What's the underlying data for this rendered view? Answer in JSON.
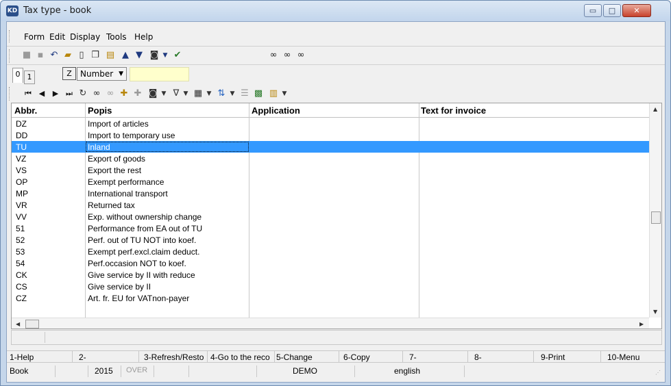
{
  "window": {
    "title": "Tax type -  book",
    "app_icon": "KD",
    "minimize_symbol": "▭",
    "maximize_symbol": "□",
    "close_symbol": "✕"
  },
  "menu": [
    "Form",
    "Edit",
    "Display",
    "Tools",
    "Help"
  ],
  "toolbar1_icons": [
    "save-icon",
    "save-as-icon",
    "undo-icon",
    "open-folder-icon",
    "new-document-icon",
    "copy-icon",
    "book-icon",
    "move-up-icon",
    "move-down-icon",
    "camera-icon",
    "dropdown-icon",
    "check-icon",
    "find-icon",
    "find-next-icon",
    "find-replace-icon"
  ],
  "tabs": [
    "0",
    "1"
  ],
  "z_button": "Z",
  "sort_select": "Number",
  "toolbar2_icons": [
    "first-record-icon",
    "previous-record-icon",
    "next-record-icon",
    "last-record-icon",
    "refresh-icon",
    "find-icon",
    "find-disabled-icon",
    "add-record-icon",
    "remove-record-icon",
    "camera-icon",
    "filter-icon",
    "export-icon",
    "sort-icon",
    "column-icon",
    "excel-icon",
    "report-icon"
  ],
  "grid": {
    "columns": [
      "Abbr.",
      "Popis",
      "Application",
      "Text for invoice"
    ],
    "rows": [
      {
        "abbr": "DZ",
        "popis": "Import of articles"
      },
      {
        "abbr": "DD",
        "popis": "Import to temporary use"
      },
      {
        "abbr": "TU",
        "popis": "Inland"
      },
      {
        "abbr": "VZ",
        "popis": "Export of goods"
      },
      {
        "abbr": "VS",
        "popis": "Export the rest"
      },
      {
        "abbr": "OP",
        "popis": "Exempt performance"
      },
      {
        "abbr": "MP",
        "popis": "International transport"
      },
      {
        "abbr": "VR",
        "popis": "Returned tax"
      },
      {
        "abbr": "VV",
        "popis": "Exp. without ownership change"
      },
      {
        "abbr": "51",
        "popis": "Performance from EA out of TU"
      },
      {
        "abbr": "52",
        "popis": "Perf. out of TU NOT into koef."
      },
      {
        "abbr": "53",
        "popis": "Exempt perf.excl.claim deduct."
      },
      {
        "abbr": "54",
        "popis": "Perf.occasion NOT to koef."
      },
      {
        "abbr": "CK",
        "popis": "Give service by II with reduce"
      },
      {
        "abbr": "CS",
        "popis": "Give service by II"
      },
      {
        "abbr": "CZ",
        "popis": "Art. fr. EU for VATnon-payer"
      }
    ]
  },
  "function_keys": [
    "1-Help",
    "2-",
    "3-Refresh/Resto",
    "4-Go to the reco",
    "5-Change",
    "6-Copy",
    "7-",
    "8-",
    "9-Print",
    "10-Menu"
  ],
  "status": {
    "book": "Book",
    "year": "2015",
    "mode": "OVER",
    "demo": "DEMO",
    "language": "english"
  },
  "colors": {
    "selection": "#3399ff",
    "input_yellow": "#ffffcc"
  }
}
